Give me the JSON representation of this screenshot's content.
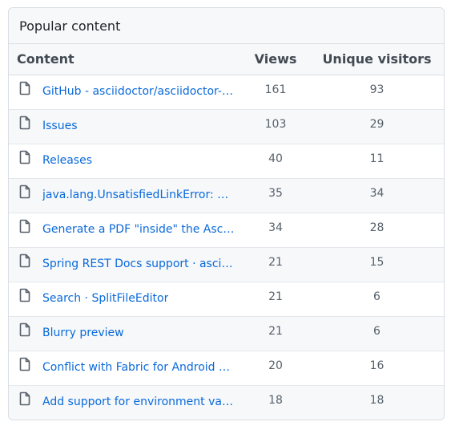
{
  "panel": {
    "title": "Popular content"
  },
  "table": {
    "columns": {
      "content": "Content",
      "views": "Views",
      "unique": "Unique visitors"
    },
    "rows": [
      {
        "icon": "file-icon",
        "title": "GitHub - asciidoctor/asciidoctor-in…",
        "views": "161",
        "unique": "93"
      },
      {
        "icon": "file-icon",
        "title": "Issues",
        "views": "103",
        "unique": "29"
      },
      {
        "icon": "file-icon",
        "title": "Releases",
        "views": "40",
        "unique": "11"
      },
      {
        "icon": "file-icon",
        "title": "java.lang.UnsatisfiedLinkError: Can'…",
        "views": "35",
        "unique": "34"
      },
      {
        "icon": "file-icon",
        "title": "Generate a PDF \"inside\" the Asciid…",
        "views": "34",
        "unique": "28"
      },
      {
        "icon": "file-icon",
        "title": "Spring REST Docs support · asciido…",
        "views": "21",
        "unique": "15"
      },
      {
        "icon": "file-icon",
        "title": "Search · SplitFileEditor",
        "views": "21",
        "unique": "6"
      },
      {
        "icon": "file-icon",
        "title": "Blurry preview",
        "views": "21",
        "unique": "6"
      },
      {
        "icon": "file-icon",
        "title": "Conflict with Fabric for Android St…",
        "views": "20",
        "unique": "16"
      },
      {
        "icon": "file-icon",
        "title": "Add support for environment varia…",
        "views": "18",
        "unique": "18"
      }
    ]
  },
  "colors": {
    "link": "#0969da",
    "header_bg": "#f6f8fa",
    "border": "#d8dee4"
  }
}
